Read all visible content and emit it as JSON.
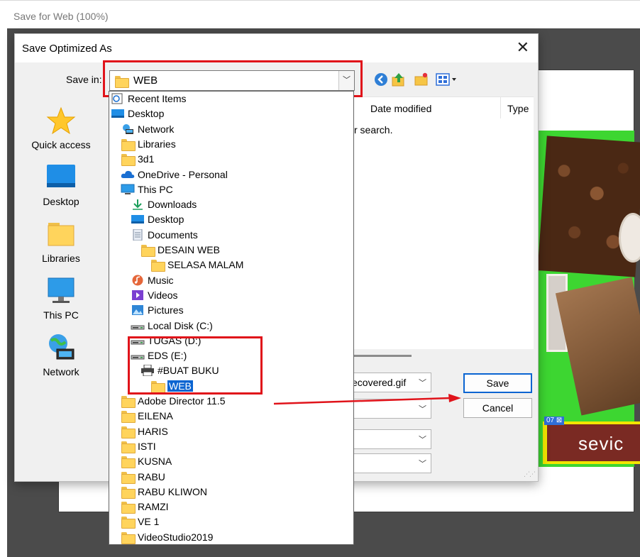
{
  "background_window": {
    "title": "Save for Web (100%)",
    "preview_text": "sevic",
    "preview_tag": "07"
  },
  "dialog": {
    "title": "Save Optimized As",
    "close_glyph": "✕",
    "save_in_label": "Save in:",
    "save_in_value": "WEB",
    "places": [
      {
        "label": "Quick access",
        "icon": "star-icon"
      },
      {
        "label": "Desktop",
        "icon": "desktop-icon"
      },
      {
        "label": "Libraries",
        "icon": "libraries-icon"
      },
      {
        "label": "This PC",
        "icon": "this-pc-icon"
      },
      {
        "label": "Network",
        "icon": "network-icon"
      }
    ],
    "columns": {
      "date_modified": "Date modified",
      "type": "Type"
    },
    "empty_message": "r search.",
    "file_name_value": "ecovered.gif",
    "save_button": "Save",
    "cancel_button": "Cancel"
  },
  "dropdown": {
    "items": [
      {
        "label": "Recent Items",
        "icon": "recent-icon"
      },
      {
        "label": "Desktop",
        "icon": "desktop-icon"
      },
      {
        "label": "Network",
        "icon": "network-icon"
      },
      {
        "label": "Libraries",
        "icon": "folder-icon"
      },
      {
        "label": "3d1",
        "icon": "folder-icon"
      },
      {
        "label": "OneDrive - Personal",
        "icon": "cloud-icon"
      },
      {
        "label": "This PC",
        "icon": "this-pc-icon"
      },
      {
        "label": "Downloads",
        "icon": "download-icon"
      },
      {
        "label": "Desktop",
        "icon": "desktop-icon"
      },
      {
        "label": "Documents",
        "icon": "documents-icon"
      },
      {
        "label": "DESAIN WEB",
        "icon": "folder-icon"
      },
      {
        "label": "SELASA MALAM",
        "icon": "folder-icon"
      },
      {
        "label": "Music",
        "icon": "music-icon"
      },
      {
        "label": "Videos",
        "icon": "videos-icon"
      },
      {
        "label": "Pictures",
        "icon": "pictures-icon"
      },
      {
        "label": "Local Disk (C:)",
        "icon": "drive-icon"
      },
      {
        "label": "TUGAS (D:)",
        "icon": "drive-icon"
      },
      {
        "label": "EDS (E:)",
        "icon": "drive-icon"
      },
      {
        "label": "#BUAT BUKU",
        "icon": "printer-icon"
      },
      {
        "label": "WEB",
        "icon": "folder-icon",
        "selected": true
      },
      {
        "label": "Adobe Director 11.5",
        "icon": "folder-icon"
      },
      {
        "label": "EILENA",
        "icon": "folder-icon"
      },
      {
        "label": "HARIS",
        "icon": "folder-icon"
      },
      {
        "label": "ISTI",
        "icon": "folder-icon"
      },
      {
        "label": "KUSNA",
        "icon": "folder-icon"
      },
      {
        "label": "RABU",
        "icon": "folder-icon"
      },
      {
        "label": "RABU KLIWON",
        "icon": "folder-icon"
      },
      {
        "label": "RAMZI",
        "icon": "folder-icon"
      },
      {
        "label": "VE 1",
        "icon": "folder-icon"
      },
      {
        "label": "VideoStudio2019",
        "icon": "folder-icon"
      }
    ]
  },
  "annotations": {
    "highlight_color": "#e0131a",
    "selection_color": "#0a64d1"
  }
}
